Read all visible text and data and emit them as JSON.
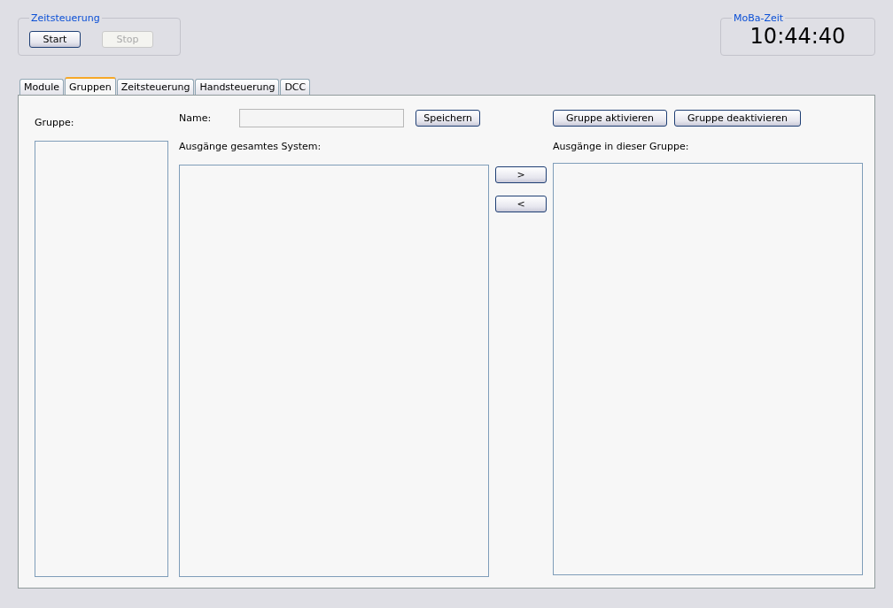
{
  "zeitsteuerung": {
    "legend": "Zeitsteuerung",
    "buttons": [
      {
        "label": "Start",
        "disabled": false
      },
      {
        "label": "Stop",
        "disabled": true
      }
    ]
  },
  "clock": {
    "legend": "MoBa-Zeit",
    "time": "10:44:40"
  },
  "tabs": [
    {
      "label": "Module",
      "selected": false
    },
    {
      "label": "Gruppen",
      "selected": true
    },
    {
      "label": "Zeitsteuerung",
      "selected": false
    },
    {
      "label": "Handsteuerung",
      "selected": false
    },
    {
      "label": "DCC",
      "selected": false
    }
  ],
  "groups": {
    "label": "Gruppe:"
  },
  "name_field": {
    "label": "Name:",
    "save_button": "Speichern"
  },
  "system_outputs": {
    "label": "Ausgänge gesamtes System:"
  },
  "move_buttons": [
    ">",
    "<"
  ],
  "group_buttons": [
    "Gruppe aktivieren",
    "Gruppe deaktivieren"
  ],
  "group_outputs": {
    "label": "Ausgänge in dieser Gruppe:"
  }
}
